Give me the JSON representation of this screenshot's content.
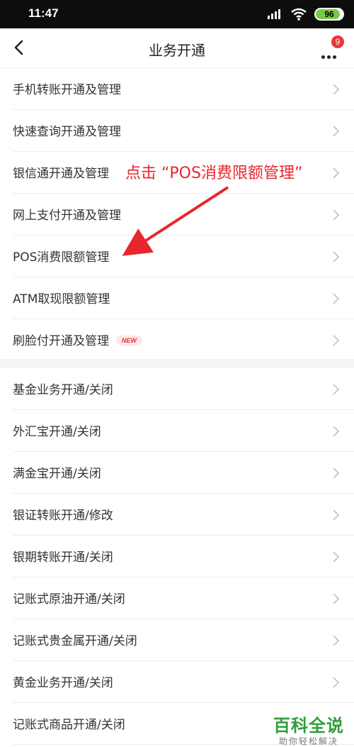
{
  "status_bar": {
    "time": "11:47",
    "battery": "96"
  },
  "nav": {
    "title": "业务开通",
    "badge_count": "9"
  },
  "group1": [
    {
      "label": "手机转账开通及管理"
    },
    {
      "label": "快速查询开通及管理"
    },
    {
      "label": "银信通开通及管理"
    },
    {
      "label": "网上支付开通及管理"
    },
    {
      "label": "POS消费限额管理"
    },
    {
      "label": "ATM取现限额管理"
    },
    {
      "label": "刷脸付开通及管理",
      "tag": "NEW"
    }
  ],
  "group2": [
    {
      "label": "基金业务开通/关闭"
    },
    {
      "label": "外汇宝开通/关闭"
    },
    {
      "label": "满金宝开通/关闭"
    },
    {
      "label": "银证转账开通/修改"
    },
    {
      "label": "银期转账开通/关闭"
    },
    {
      "label": "记账式原油开通/关闭"
    },
    {
      "label": "记账式贵金属开通/关闭"
    },
    {
      "label": "黄金业务开通/关闭"
    },
    {
      "label": "记账式商品开通/关闭"
    }
  ],
  "annotation": {
    "text": "点击 “POS消费限额管理”"
  },
  "watermark": {
    "main": "百科全说",
    "sub": "助你轻松解决"
  },
  "colors": {
    "accent_red": "#e8373d",
    "annotation_red": "#e8262d",
    "watermark_green": "#2e9f3b"
  },
  "icons": {
    "back": "back-arrow-icon",
    "more": "more-dots-icon",
    "chevron": "chevron-right-icon"
  }
}
